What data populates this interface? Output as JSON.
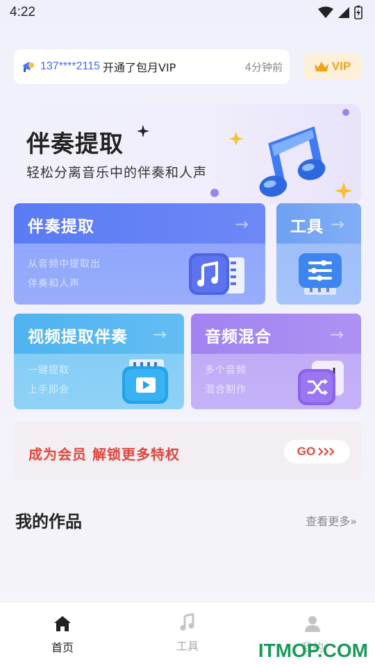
{
  "status": {
    "time": "4:22"
  },
  "notice": {
    "phone": "137****2115",
    "text": "开通了包月VIP",
    "time": "4分钟前"
  },
  "vip_button": {
    "label": "VIP"
  },
  "banner": {
    "title": "伴奏提取",
    "subtitle": "轻松分离音乐中的伴奏和人声"
  },
  "cards": {
    "accompaniment": {
      "title": "伴奏提取",
      "desc_line1": "从音频中提取出",
      "desc_line2": "伴奏和人声"
    },
    "tools": {
      "title": "工具"
    },
    "video": {
      "title": "视频提取伴奏",
      "desc_line1": "一键提取",
      "desc_line2": "上手即会"
    },
    "mix": {
      "title": "音频混合",
      "desc_line1": "多个音频",
      "desc_line2": "混合制作"
    }
  },
  "member": {
    "text": "成为会员 解锁更多特权",
    "button": "GO"
  },
  "works": {
    "title": "我的作品",
    "more": "查看更多"
  },
  "tabbar": {
    "items": [
      {
        "label": "首页"
      },
      {
        "label": "工具"
      },
      {
        "label": "我的"
      }
    ]
  },
  "watermark": "ITMOP.COM",
  "colors": {
    "accent_red": "#e0463e",
    "vip_gold": "#f0a41c",
    "link_blue": "#3b6cf0"
  }
}
